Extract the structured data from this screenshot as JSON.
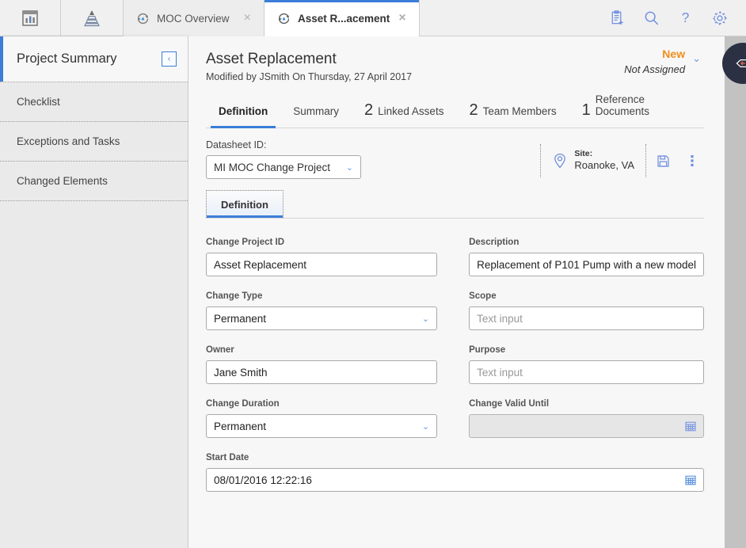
{
  "topbar": {
    "icons": [
      {
        "name": "dashboard-icon",
        "label": "Dashboards"
      },
      {
        "name": "hierarchy-pyramid-icon",
        "label": "Hierarchy"
      }
    ],
    "tabs": [
      {
        "label": "MOC Overview",
        "icon": "moc-circular-arrow-icon",
        "active": false,
        "close": "×"
      },
      {
        "label": "Asset R...acement",
        "icon": "moc-circular-arrow-icon",
        "active": true,
        "close": "×"
      }
    ],
    "actions": [
      {
        "name": "new-record-icon",
        "label": "New"
      },
      {
        "name": "search-icon",
        "label": "Search"
      },
      {
        "name": "help-icon",
        "label": "Help"
      },
      {
        "name": "gear-icon",
        "label": "Settings"
      }
    ]
  },
  "sidebar": {
    "title": "Project Summary",
    "collapse_glyph": "‹",
    "items": [
      {
        "label": "Checklist"
      },
      {
        "label": "Exceptions and Tasks"
      },
      {
        "label": "Changed Elements"
      }
    ]
  },
  "header": {
    "title": "Asset Replacement",
    "subtitle": "Modified by JSmith On Thursday, 27 April 2017",
    "status": "New",
    "assignment": "Not Assigned",
    "status_chevron": "⌄"
  },
  "tabs": [
    {
      "count": "",
      "label": "Definition",
      "active": true
    },
    {
      "count": "",
      "label": "Summary",
      "active": false
    },
    {
      "count": "2",
      "label": "Linked Assets",
      "active": false
    },
    {
      "count": "2",
      "label": "Team Members",
      "active": false
    },
    {
      "count": "1",
      "label": "Reference Documents",
      "active": false
    }
  ],
  "datasheet": {
    "label": "Datasheet ID:",
    "value": "MI MOC Change Project",
    "chevron": "⌄",
    "site_key": "Site:",
    "site_value": "Roanoke, VA",
    "save_icon": "save-icon",
    "more_icon": "more-vertical-icon"
  },
  "subtab": {
    "label": "Definition"
  },
  "form": {
    "fields": [
      {
        "label": "Change Project ID",
        "value": "Asset Replacement",
        "type": "text",
        "placeholder": "",
        "disabled": false
      },
      {
        "label": "Description",
        "value": "Replacement of P101 Pump with a new model",
        "type": "text",
        "placeholder": "",
        "disabled": false
      },
      {
        "label": "Change Type",
        "value": "Permanent",
        "type": "select",
        "placeholder": "",
        "disabled": false
      },
      {
        "label": "Scope",
        "value": "",
        "type": "text",
        "placeholder": "Text input",
        "disabled": false
      },
      {
        "label": "Owner",
        "value": "Jane Smith",
        "type": "text",
        "placeholder": "",
        "disabled": false
      },
      {
        "label": "Purpose",
        "value": "",
        "type": "text",
        "placeholder": "Text input",
        "disabled": false
      },
      {
        "label": "Change Duration",
        "value": "Permanent",
        "type": "select",
        "placeholder": "",
        "disabled": false
      },
      {
        "label": "Change Valid Until",
        "value": "",
        "type": "date",
        "placeholder": "",
        "disabled": true
      },
      {
        "label": "Start Date",
        "value": "08/01/2016 12:22:16",
        "type": "date",
        "placeholder": "",
        "disabled": false
      }
    ]
  },
  "fab": {
    "name": "collapse-panel-icon"
  },
  "colors": {
    "accent_blue": "#3b7dd8",
    "status_orange": "#f08c1b",
    "icon_blue": "#6f8ee0",
    "panel_gray": "#eaeaea",
    "rail_gray": "#c2c2c2",
    "fab_dark": "#2b3042"
  }
}
